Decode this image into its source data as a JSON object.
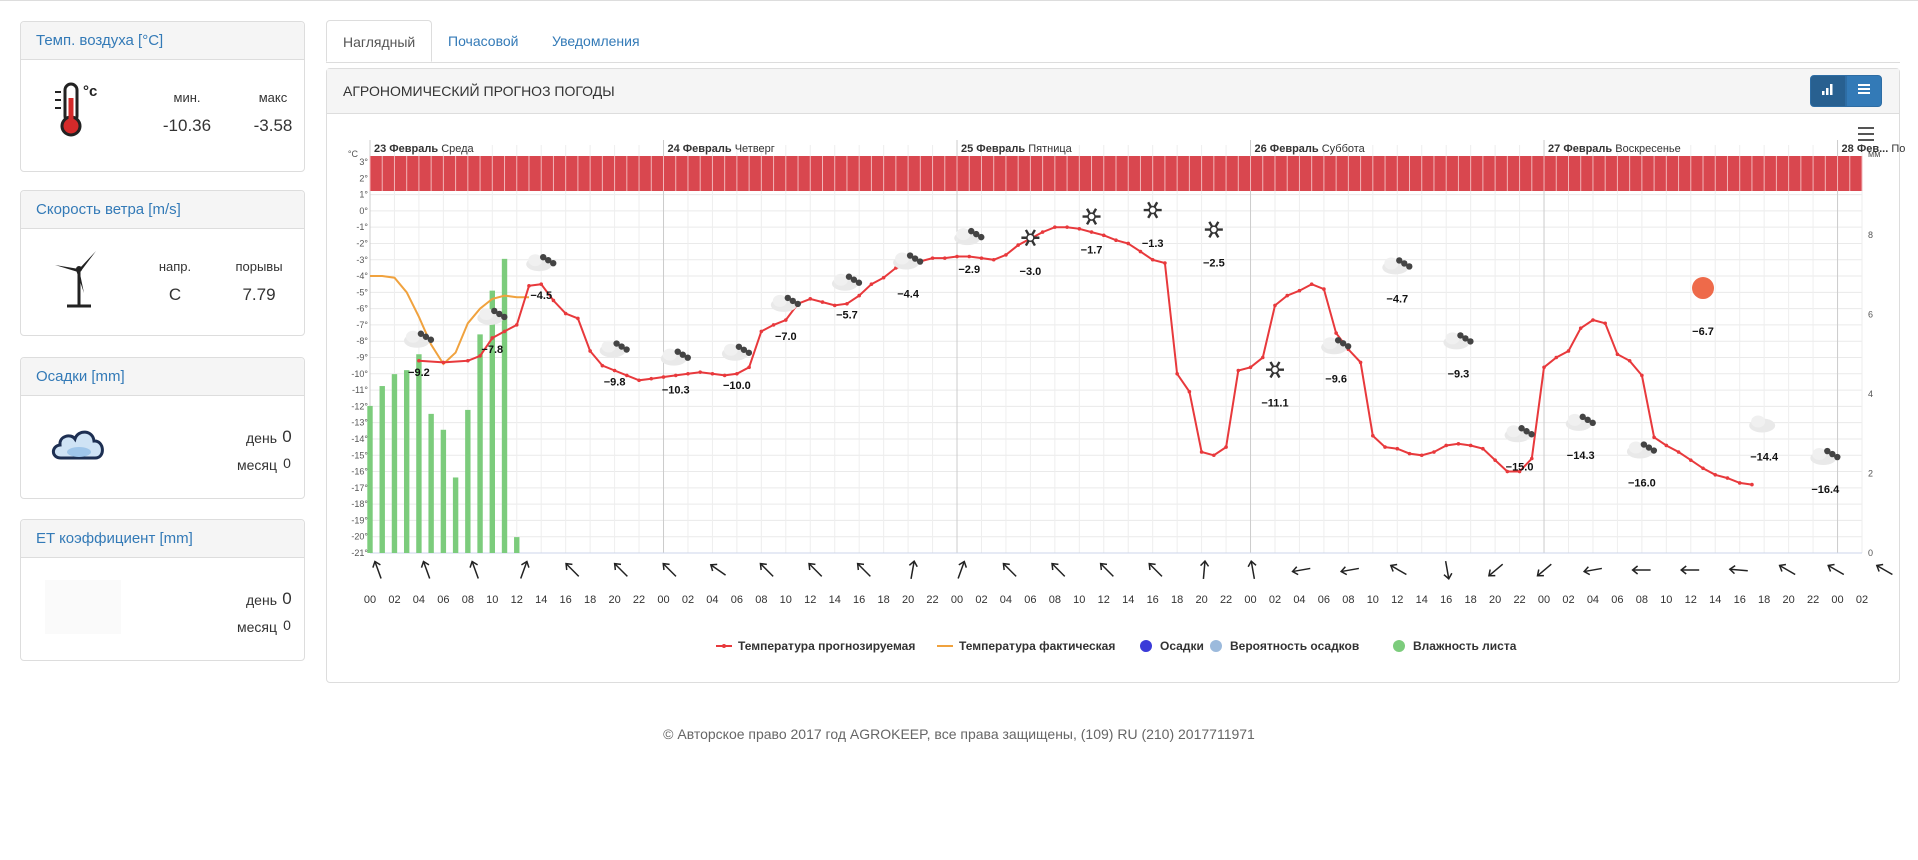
{
  "widgets": {
    "temp": {
      "title": "Темп. воздуха [°C]",
      "min_label": "мин.",
      "max_label": "макс",
      "min_value": "-10.36",
      "max_value": "-3.58"
    },
    "wind": {
      "title": "Скорость ветра [m/s]",
      "dir_label": "напр.",
      "gust_label": "порывы",
      "dir_value": "С",
      "gust_value": "7.79"
    },
    "precip": {
      "title": "Осадки [mm]",
      "day_label": "день",
      "day_value": "0",
      "month_label": "месяц",
      "month_value": "0"
    },
    "et": {
      "title": "ET коэффициент [mm]",
      "day_label": "день",
      "day_value": "0",
      "month_label": "месяц",
      "month_value": "0"
    }
  },
  "tabs": [
    "Наглядный",
    "Почасовой",
    "Уведомления"
  ],
  "main": {
    "title": "АГРОНОМИЧЕСКИЙ ПРОГНОЗ ПОГОДЫ"
  },
  "colors": {
    "link": "#337ab7",
    "forecast": "#e8393c",
    "actual": "#f0a23e",
    "precip": "#3b3bd8",
    "precip_prob": "#9cbadc",
    "leaf": "#7ccc7c",
    "band": "#d9474f"
  },
  "chart_data": {
    "type": "line",
    "yunit": "°C",
    "y2unit": "мм",
    "ylim": [
      -21,
      3
    ],
    "y2lim": [
      0,
      9
    ],
    "ytick_labels": [
      "3°",
      "2°",
      "1°",
      "0°",
      "-1°",
      "-2°",
      "-3°",
      "-4°",
      "-5°",
      "-6°",
      "-7°",
      "-8°",
      "-9°",
      "-10°",
      "-11°",
      "-12°",
      "-13°",
      "-14°",
      "-15°",
      "-16°",
      "-17°",
      "-18°",
      "-19°",
      "-20°",
      "-21°"
    ],
    "y2tick_labels": [
      "0",
      "2",
      "4",
      "6",
      "8"
    ],
    "day_headers": [
      {
        "date": "23 Февраль",
        "weekday": "Среда"
      },
      {
        "date": "24 Февраль",
        "weekday": "Четверг"
      },
      {
        "date": "25 Февраль",
        "weekday": "Пятница"
      },
      {
        "date": "26 Февраль",
        "weekday": "Суббота"
      },
      {
        "date": "27 Февраль",
        "weekday": "Воскресенье"
      },
      {
        "date": "28 Фев...",
        "weekday": "По"
      }
    ],
    "x_labels": [
      "00",
      "02",
      "04",
      "06",
      "08",
      "10",
      "12",
      "14",
      "16",
      "18",
      "20",
      "22",
      "00",
      "02",
      "04",
      "06",
      "08",
      "10",
      "12",
      "14",
      "16",
      "18",
      "20",
      "22",
      "00",
      "02",
      "04",
      "06",
      "08",
      "10",
      "12",
      "14",
      "16",
      "18",
      "20",
      "22",
      "00",
      "02",
      "04",
      "06",
      "08",
      "10",
      "12",
      "14",
      "16",
      "18",
      "20",
      "22",
      "00",
      "02",
      "04",
      "06",
      "08",
      "10",
      "12",
      "14",
      "16",
      "18",
      "20",
      "22",
      "00",
      "02"
    ],
    "series": [
      {
        "name": "Температура прогнозируемая",
        "points": [
          [
            4,
            -9.2
          ],
          [
            6,
            -9.3
          ],
          [
            8,
            -9.2
          ],
          [
            9,
            -8.9
          ],
          [
            10,
            -7.8
          ],
          [
            11,
            -7.4
          ],
          [
            12,
            -7.0
          ],
          [
            13,
            -4.6
          ],
          [
            14,
            -4.5
          ],
          [
            15,
            -5.5
          ],
          [
            16,
            -6.3
          ],
          [
            17,
            -6.6
          ],
          [
            18,
            -8.6
          ],
          [
            19,
            -9.5
          ],
          [
            20,
            -9.8
          ],
          [
            21,
            -10.1
          ],
          [
            22,
            -10.4
          ],
          [
            23,
            -10.3
          ],
          [
            24,
            -10.2
          ],
          [
            25,
            -10.1
          ],
          [
            26,
            -10.0
          ],
          [
            27,
            -9.9
          ],
          [
            28,
            -10.0
          ],
          [
            29,
            -10.1
          ],
          [
            30,
            -10.0
          ],
          [
            31,
            -9.6
          ],
          [
            32,
            -7.4
          ],
          [
            33,
            -7.0
          ],
          [
            34,
            -6.7
          ],
          [
            35,
            -5.7
          ],
          [
            36,
            -5.4
          ],
          [
            37,
            -5.6
          ],
          [
            38,
            -5.8
          ],
          [
            39,
            -5.7
          ],
          [
            40,
            -5.2
          ],
          [
            41,
            -4.5
          ],
          [
            42,
            -4.1
          ],
          [
            43,
            -3.5
          ],
          [
            44,
            -3.3
          ],
          [
            45,
            -3.1
          ],
          [
            46,
            -2.9
          ],
          [
            47,
            -2.9
          ],
          [
            48,
            -2.8
          ],
          [
            49,
            -2.8
          ],
          [
            50,
            -2.9
          ],
          [
            51,
            -3.0
          ],
          [
            52,
            -2.7
          ],
          [
            53,
            -2.1
          ],
          [
            54,
            -1.7
          ],
          [
            55,
            -1.3
          ],
          [
            56,
            -1.0
          ],
          [
            57,
            -1.0
          ],
          [
            58,
            -1.1
          ],
          [
            59,
            -1.3
          ],
          [
            60,
            -1.5
          ],
          [
            61,
            -1.8
          ],
          [
            62,
            -2.0
          ],
          [
            63,
            -2.5
          ],
          [
            64,
            -3.0
          ],
          [
            65,
            -3.2
          ],
          [
            66,
            -10.0
          ],
          [
            67,
            -11.1
          ],
          [
            68,
            -14.8
          ],
          [
            69,
            -15.0
          ],
          [
            70,
            -14.5
          ],
          [
            71,
            -9.8
          ],
          [
            72,
            -9.6
          ],
          [
            73,
            -9.0
          ],
          [
            74,
            -5.8
          ],
          [
            75,
            -5.2
          ],
          [
            76,
            -4.9
          ],
          [
            77,
            -4.5
          ],
          [
            78,
            -4.8
          ],
          [
            79,
            -7.5
          ],
          [
            80,
            -8.5
          ],
          [
            81,
            -9.3
          ],
          [
            82,
            -13.8
          ],
          [
            83,
            -14.5
          ],
          [
            84,
            -14.6
          ],
          [
            85,
            -14.9
          ],
          [
            86,
            -15.0
          ],
          [
            87,
            -14.8
          ],
          [
            88,
            -14.4
          ],
          [
            89,
            -14.3
          ],
          [
            90,
            -14.4
          ],
          [
            91,
            -14.6
          ],
          [
            92,
            -15.3
          ],
          [
            93,
            -16.0
          ],
          [
            94,
            -16.0
          ],
          [
            95,
            -15.2
          ],
          [
            96,
            -9.6
          ],
          [
            97,
            -9.0
          ],
          [
            98,
            -8.6
          ],
          [
            99,
            -7.2
          ],
          [
            100,
            -6.7
          ],
          [
            101,
            -6.9
          ],
          [
            102,
            -8.8
          ],
          [
            103,
            -9.2
          ],
          [
            104,
            -10.1
          ],
          [
            105,
            -13.9
          ],
          [
            106,
            -14.4
          ],
          [
            107,
            -14.8
          ],
          [
            108,
            -15.3
          ],
          [
            109,
            -15.8
          ],
          [
            110,
            -16.2
          ],
          [
            111,
            -16.4
          ],
          [
            112,
            -16.7
          ],
          [
            113,
            -16.8
          ]
        ]
      },
      {
        "name": "Температура фактическая",
        "points": [
          [
            0,
            -4.0
          ],
          [
            1,
            -4.0
          ],
          [
            2,
            -4.1
          ],
          [
            3,
            -5.0
          ],
          [
            4,
            -6.5
          ],
          [
            5,
            -8.2
          ],
          [
            6,
            -9.4
          ],
          [
            7,
            -8.7
          ],
          [
            8,
            -6.9
          ],
          [
            9,
            -6.0
          ],
          [
            10,
            -5.4
          ],
          [
            11,
            -5.2
          ],
          [
            12,
            -5.3
          ],
          [
            13,
            -5.3
          ]
        ]
      },
      {
        "name": "Осадки",
        "points": []
      },
      {
        "name": "Вероятность осадков",
        "points": []
      },
      {
        "name": "Влажность листа",
        "bars": [
          [
            0,
            3.7
          ],
          [
            1,
            4.2
          ],
          [
            2,
            4.5
          ],
          [
            3,
            4.6
          ],
          [
            4,
            5.0
          ],
          [
            5,
            3.5
          ],
          [
            6,
            3.1
          ],
          [
            7,
            1.9
          ],
          [
            8,
            3.6
          ],
          [
            9,
            5.5
          ],
          [
            10,
            6.6
          ],
          [
            11,
            7.4
          ],
          [
            12,
            0.4
          ]
        ]
      }
    ],
    "labels": [
      {
        "x": 4,
        "y": -9.2,
        "text": "−9.2"
      },
      {
        "x": 10,
        "y": -7.8,
        "text": "−7.8"
      },
      {
        "x": 14,
        "y": -4.5,
        "text": "−4.5"
      },
      {
        "x": 20,
        "y": -9.8,
        "text": "−9.8"
      },
      {
        "x": 25,
        "y": -10.3,
        "text": "−10.3"
      },
      {
        "x": 30,
        "y": -10.0,
        "text": "−10.0"
      },
      {
        "x": 34,
        "y": -7.0,
        "text": "−7.0"
      },
      {
        "x": 39,
        "y": -5.7,
        "text": "−5.7"
      },
      {
        "x": 44,
        "y": -4.4,
        "text": "−4.4"
      },
      {
        "x": 49,
        "y": -2.9,
        "text": "−2.9"
      },
      {
        "x": 54,
        "y": -3.0,
        "text": "−3.0"
      },
      {
        "x": 59,
        "y": -1.7,
        "text": "−1.7"
      },
      {
        "x": 64,
        "y": -1.3,
        "text": "−1.3"
      },
      {
        "x": 69,
        "y": -2.5,
        "text": "−2.5"
      },
      {
        "x": 74,
        "y": -11.1,
        "text": "−11.1"
      },
      {
        "x": 79,
        "y": -9.6,
        "text": "−9.6"
      },
      {
        "x": 84,
        "y": -4.7,
        "text": "−4.7"
      },
      {
        "x": 89,
        "y": -9.3,
        "text": "−9.3"
      },
      {
        "x": 94,
        "y": -15.0,
        "text": "−15.0"
      },
      {
        "x": 99,
        "y": -14.3,
        "text": "−14.3"
      },
      {
        "x": 104,
        "y": -16.0,
        "text": "−16.0"
      },
      {
        "x": 109,
        "y": -6.7,
        "text": "−6.7"
      },
      {
        "x": 114,
        "y": -14.4,
        "text": "−14.4"
      },
      {
        "x": 119,
        "y": -16.4,
        "text": "−16.4"
      }
    ],
    "weather_icons": [
      "cloud-snow-icon",
      "cloud-snow-icon",
      "cloud-snow-icon",
      "cloud-snow-icon",
      "cloud-snow-icon",
      "cloud-snow-icon",
      "cloud-snow-icon",
      "cloud-snow-icon",
      "cloud-snow-icon",
      "cloud-snow-icon",
      "snowflake-icon",
      "snowflake-icon",
      "snowflake-icon",
      "snowflake-icon",
      "snowflake-icon",
      "cloud-snow-icon",
      "cloud-snow-icon",
      "cloud-snow-icon",
      "cloud-snow-icon",
      "cloud-snow-icon",
      "cloud-snow-icon",
      "sun-icon",
      "cloud-icon",
      "cloud-snow-icon"
    ],
    "wind_dirs_deg": [
      250,
      250,
      250,
      290,
      225,
      225,
      225,
      215,
      225,
      225,
      225,
      280,
      290,
      225,
      225,
      225,
      225,
      275,
      260,
      170,
      170,
      210,
      80,
      140,
      140,
      170,
      180,
      180,
      185,
      210,
      210,
      210,
      230,
      240
    ],
    "legend": [
      "Температура прогнозируемая",
      "Температура фактическая",
      "Осадки",
      "Вероятность осадков",
      "Влажность листа"
    ]
  },
  "footer": "© Авторское право 2017 год AGROKEEP, все права защищены, (109) RU (210) 2017711971"
}
